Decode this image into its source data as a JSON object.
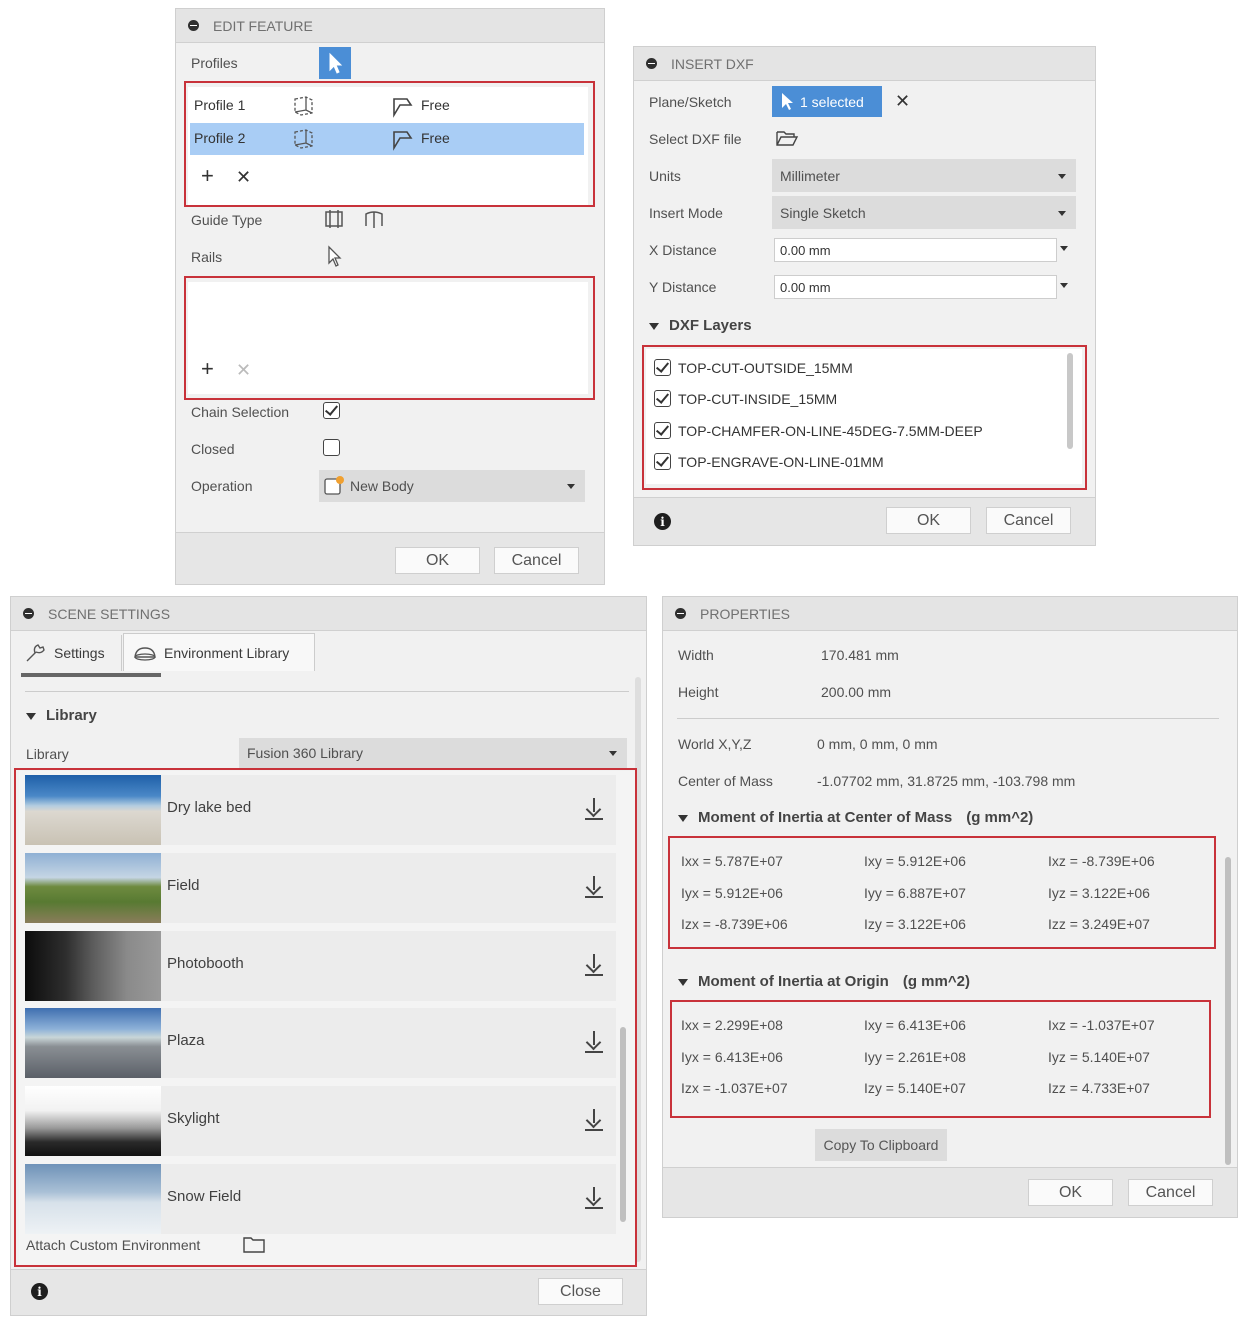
{
  "edit_feature": {
    "title": "EDIT FEATURE",
    "profiles_label": "Profiles",
    "profiles": [
      {
        "name": "Profile 1",
        "mode": "Free"
      },
      {
        "name": "Profile 2",
        "mode": "Free"
      }
    ],
    "guide_type_label": "Guide Type",
    "rails_label": "Rails",
    "chain_selection_label": "Chain Selection",
    "chain_selection_checked": true,
    "closed_label": "Closed",
    "closed_checked": false,
    "operation_label": "Operation",
    "operation_value": "New Body",
    "ok": "OK",
    "cancel": "Cancel"
  },
  "insert_dxf": {
    "title": "INSERT DXF",
    "plane_label": "Plane/Sketch",
    "plane_value": "1 selected",
    "select_file_label": "Select DXF file",
    "units_label": "Units",
    "units_value": "Millimeter",
    "insert_mode_label": "Insert Mode",
    "insert_mode_value": "Single Sketch",
    "x_distance_label": "X Distance",
    "x_distance_value": "0.00 mm",
    "y_distance_label": "Y Distance",
    "y_distance_value": "0.00 mm",
    "layers_header": "DXF Layers",
    "layers": [
      "TOP-CUT-OUTSIDE_15MM",
      "TOP-CUT-INSIDE_15MM",
      "TOP-CHAMFER-ON-LINE-45DEG-7.5MM-DEEP",
      "TOP-ENGRAVE-ON-LINE-01MM"
    ],
    "ok": "OK",
    "cancel": "Cancel"
  },
  "scene_settings": {
    "title": "SCENE SETTINGS",
    "tabs": [
      "Settings",
      "Environment Library"
    ],
    "library_header": "Library",
    "library_label": "Library",
    "library_value": "Fusion 360 Library",
    "environments": [
      "Dry lake bed",
      "Field",
      "Photobooth",
      "Plaza",
      "Skylight",
      "Snow Field"
    ],
    "attach_label": "Attach Custom Environment",
    "close": "Close"
  },
  "properties": {
    "title": "PROPERTIES",
    "width_label": "Width",
    "width_value": "170.481 mm",
    "height_label": "Height",
    "height_value": "200.00 mm",
    "world_label": "World X,Y,Z",
    "world_value": "0 mm, 0 mm, 0 mm",
    "com_label": "Center of Mass",
    "com_value": "-1.07702 mm, 31.8725 mm, -103.798 mm",
    "moi_com_header": "Moment of Inertia at Center of Mass",
    "moi_com_unit": "(g mm^2)",
    "moi_com": [
      [
        "Ixx = 5.787E+07",
        "Ixy = 5.912E+06",
        "Ixz = -8.739E+06"
      ],
      [
        "Iyx = 5.912E+06",
        "Iyy = 6.887E+07",
        "Iyz = 3.122E+06"
      ],
      [
        "Izx = -8.739E+06",
        "Izy = 3.122E+06",
        "Izz = 3.249E+07"
      ]
    ],
    "moi_origin_header": "Moment of Inertia at Origin",
    "moi_origin_unit": "(g mm^2)",
    "moi_origin": [
      [
        "Ixx = 2.299E+08",
        "Ixy = 6.413E+06",
        "Ixz = -1.037E+07"
      ],
      [
        "Iyx = 6.413E+06",
        "Iyy = 2.261E+08",
        "Iyz = 5.140E+07"
      ],
      [
        "Izx = -1.037E+07",
        "Izy = 5.140E+07",
        "Izz = 4.733E+07"
      ]
    ],
    "copy_button": "Copy To Clipboard",
    "ok": "OK",
    "cancel": "Cancel"
  },
  "colors": {
    "highlight": "#c8323a",
    "selection": "#a9cdf5",
    "accent": "#4b8ed6"
  }
}
